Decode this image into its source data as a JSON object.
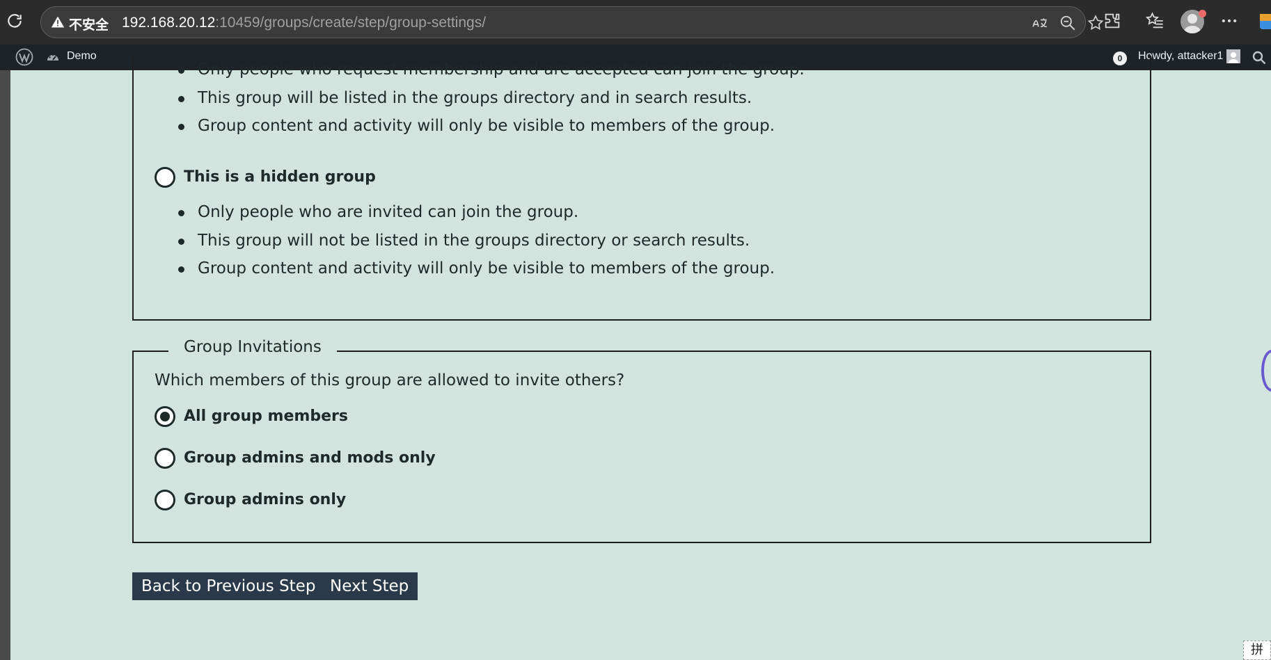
{
  "browser": {
    "security_label": "不安全",
    "url_host": "192.168.20.12",
    "url_rest": ":10459/groups/create/step/group-settings/"
  },
  "adminbar": {
    "site_name": "Demo",
    "notification_count": "0",
    "greeting": "Howdy, attacker1"
  },
  "privacy": {
    "private_bullets": [
      "Only people who request membership and are accepted can join the group.",
      "This group will be listed in the groups directory and in search results.",
      "Group content and activity will only be visible to members of the group."
    ],
    "hidden_label": "This is a hidden group",
    "hidden_bullets": [
      "Only people who are invited can join the group.",
      "This group will not be listed in the groups directory or search results.",
      "Group content and activity will only be visible to members of the group."
    ]
  },
  "invitations": {
    "legend": "Group Invitations",
    "question": "Which members of this group are allowed to invite others?",
    "options": [
      {
        "label": "All group members",
        "checked": true
      },
      {
        "label": "Group admins and mods only",
        "checked": false
      },
      {
        "label": "Group admins only",
        "checked": false
      }
    ]
  },
  "buttons": {
    "back": "Back to Previous Step",
    "next": "Next Step"
  },
  "ime_indicator": "拼"
}
